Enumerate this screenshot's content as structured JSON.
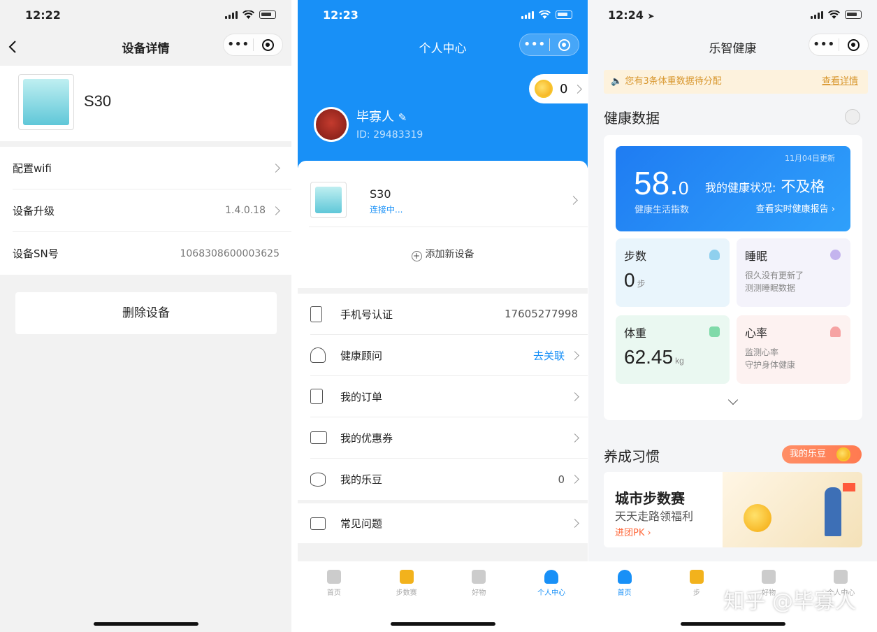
{
  "screen1": {
    "time": "12:22",
    "nav_title": "设备详情",
    "device_name": "S30",
    "rows": [
      {
        "label": "配置wifi",
        "value": ""
      },
      {
        "label": "设备升级",
        "value": "1.4.0.18"
      },
      {
        "label": "设备SN号",
        "value": "1068308600003625"
      }
    ],
    "delete_label": "删除设备"
  },
  "screen2": {
    "time": "12:23",
    "nav_title": "个人中心",
    "coin_count": "0",
    "user_name": "毕寡人",
    "user_id": "ID: 29483319",
    "device": {
      "name": "S30",
      "status": "连接中..."
    },
    "add_device": "添加新设备",
    "rows": [
      {
        "label": "手机号认证",
        "value": "17605277998",
        "icon": "phone-icon"
      },
      {
        "label": "健康顾问",
        "value": "去关联",
        "icon": "person-icon"
      },
      {
        "label": "我的订单",
        "value": "",
        "icon": "order-icon"
      },
      {
        "label": "我的优惠券",
        "value": "",
        "icon": "coupon-icon"
      },
      {
        "label": "我的乐豆",
        "value": "0",
        "icon": "coins-icon"
      }
    ],
    "faq": "常见问题",
    "tabs": [
      "首页",
      "步数赛",
      "好物",
      "个人中心"
    ],
    "active_tab": 3
  },
  "screen3": {
    "time": "12:24",
    "nav_title": "乐智健康",
    "notice": "您有3条体重数据待分配",
    "notice_link": "查看详情",
    "health_title": "健康数据",
    "score": {
      "updated": "11月04日更新",
      "value_int": "58.",
      "value_dec": "0",
      "label": "健康生活指数",
      "status_prefix": "我的健康状况:",
      "status_value": "不及格",
      "report_link": "查看实时健康报告"
    },
    "tiles": [
      {
        "title": "步数",
        "value": "0",
        "unit": "步",
        "desc": ""
      },
      {
        "title": "睡眠",
        "value": "",
        "unit": "",
        "desc": "很久没有更新了\n测测睡眠数据"
      },
      {
        "title": "体重",
        "value": "62.45",
        "unit": "kg",
        "desc": ""
      },
      {
        "title": "心率",
        "value": "",
        "unit": "",
        "desc": "监测心率\n守护身体健康"
      }
    ],
    "habit_title": "养成习惯",
    "ledou_pill": "我的乐豆",
    "banner": {
      "title": "城市步数赛",
      "subtitle": "天天走路领福利",
      "link": "进团PK"
    },
    "tabs": [
      "首页",
      "步",
      "好物",
      "个人中心"
    ],
    "watermark": "知乎 @毕寡人"
  },
  "colors": {
    "brand_blue": "#1890f7",
    "warning": "#d8962c",
    "orange": "#ff7a50"
  }
}
